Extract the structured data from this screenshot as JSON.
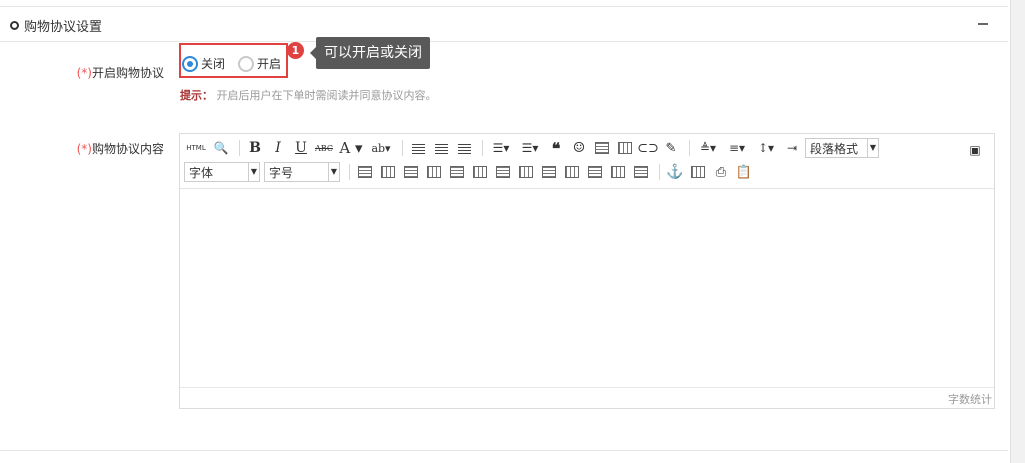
{
  "panel": {
    "title": "购物协议设置"
  },
  "form": {
    "enable": {
      "required_mark": "(*)",
      "label": "开启购物协议",
      "options": [
        {
          "label": "关闭",
          "checked": true
        },
        {
          "label": "开启",
          "checked": false
        }
      ],
      "badge": "1",
      "tooltip": "可以开启或关闭",
      "hint_label": "提示：",
      "hint_text": "开启后用户在下单时需阅读并同意协议内容。"
    },
    "content": {
      "required_mark": "(*)",
      "label": "购物协议内容"
    }
  },
  "editor": {
    "html_label": "HTML",
    "paragraph_select": "段落格式",
    "font_select": "字体",
    "size_select": "字号",
    "word_count_label": "字数统计",
    "toolbar_row1": [
      "source-html",
      "find-replace",
      "bold",
      "italic",
      "underline",
      "strikethrough",
      "font-color",
      "background-color",
      "align-left",
      "align-center",
      "align-right",
      "ordered-list",
      "unordered-list",
      "blockquote",
      "emoticon",
      "image",
      "video",
      "link",
      "eraser",
      "paragraph-spacing-top",
      "paragraph-spacing-bottom",
      "line-height",
      "indent"
    ],
    "toolbar_row2": [
      "insert-table",
      "table-props",
      "caption",
      "insert-row",
      "insert-col",
      "merge",
      "split",
      "delete-row",
      "delete-col",
      "table-left",
      "table-center",
      "table-right",
      "anchor",
      "template",
      "print",
      "paste"
    ],
    "accent": "#2e8ad8",
    "highlight": "#e04141"
  }
}
